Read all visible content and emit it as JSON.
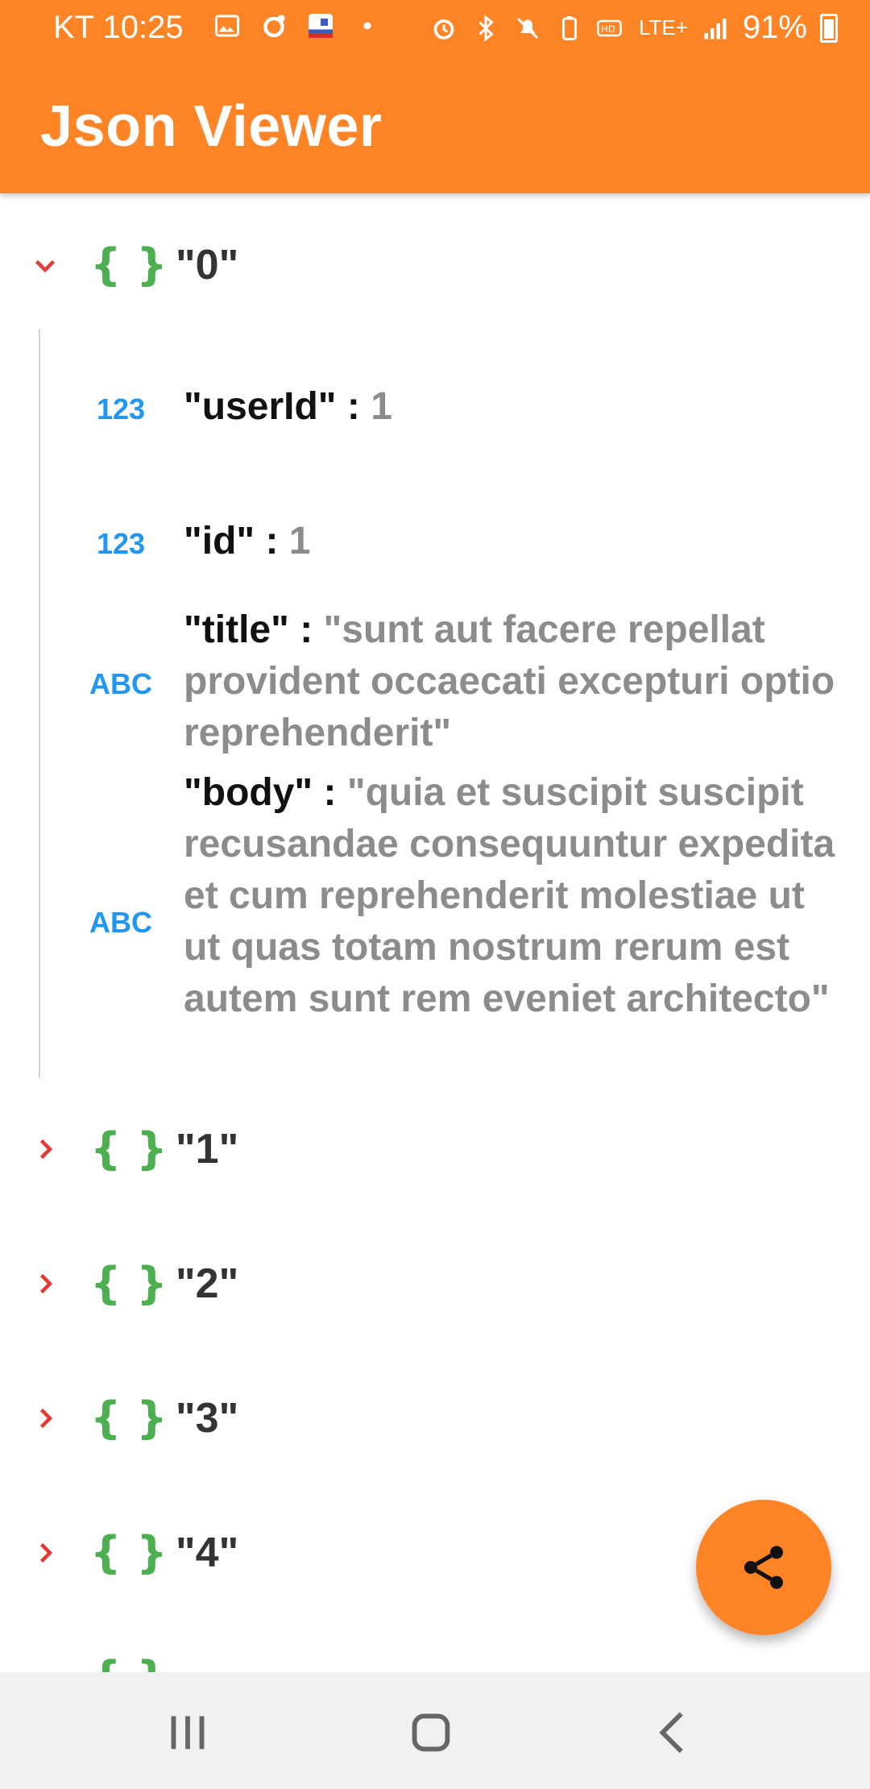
{
  "status_bar": {
    "carrier_time": "KT 10:25",
    "battery": "91%",
    "network": "LTE+"
  },
  "app": {
    "title": "Json Viewer",
    "accent_color": "#FF8426"
  },
  "tree": {
    "root": {
      "key": "\"0\"",
      "expanded": true,
      "children": [
        {
          "type": "123",
          "key": "\"userId\"",
          "value": "1"
        },
        {
          "type": "123",
          "key": "\"id\"",
          "value": "1"
        },
        {
          "type": "ABC",
          "key": "\"title\"",
          "value": "\"sunt aut facere repellat provident occaecati excepturi optio reprehenderit\""
        },
        {
          "type": "ABC",
          "key": "\"body\"",
          "value": "\"quia et suscipit suscipit recusandae consequuntur expedita et cum reprehenderit molestiae ut ut quas totam nostrum rerum est autem sunt rem eveniet architecto\""
        }
      ]
    },
    "collapsed_nodes": [
      {
        "key": "\"1\""
      },
      {
        "key": "\"2\""
      },
      {
        "key": "\"3\""
      },
      {
        "key": "\"4\""
      }
    ],
    "brace_symbol": "{ }",
    "separator": " : "
  },
  "fab": {
    "icon": "share-icon"
  },
  "navbar": {
    "icons": [
      "recent-apps-icon",
      "home-icon",
      "back-icon"
    ]
  }
}
